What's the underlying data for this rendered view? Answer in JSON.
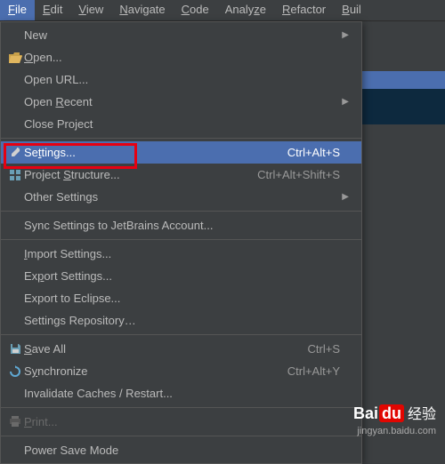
{
  "menubar": {
    "items": [
      {
        "pre": "",
        "u": "F",
        "post": "ile",
        "active": true
      },
      {
        "pre": "",
        "u": "E",
        "post": "dit"
      },
      {
        "pre": "",
        "u": "V",
        "post": "iew"
      },
      {
        "pre": "",
        "u": "N",
        "post": "avigate"
      },
      {
        "pre": "",
        "u": "C",
        "post": "ode"
      },
      {
        "pre": "Analy",
        "u": "z",
        "post": "e"
      },
      {
        "pre": "",
        "u": "R",
        "post": "efactor"
      },
      {
        "pre": "",
        "u": "B",
        "post": "uil"
      }
    ]
  },
  "menu": {
    "new": {
      "label": "New",
      "arrow": true
    },
    "open": {
      "pre": "",
      "u": "O",
      "post": "pen..."
    },
    "open_url": {
      "label": "Open URL..."
    },
    "open_recent": {
      "pre": "Open ",
      "u": "R",
      "post": "ecent",
      "arrow": true
    },
    "close_project": {
      "pre": "Close Pro",
      "u": "j",
      "post": "ect"
    },
    "settings": {
      "pre": "Se",
      "u": "t",
      "post": "tings...",
      "shortcut": "Ctrl+Alt+S"
    },
    "project_structure": {
      "pre": "Project ",
      "u": "S",
      "post": "tructure...",
      "shortcut": "Ctrl+Alt+Shift+S"
    },
    "other_settings": {
      "label": "Other Settings",
      "arrow": true
    },
    "sync_settings": {
      "label": "Sync Settings to JetBrains Account..."
    },
    "import_settings": {
      "pre": "",
      "u": "I",
      "post": "mport Settings..."
    },
    "export_settings": {
      "pre": "Ex",
      "u": "p",
      "post": "ort Settings..."
    },
    "export_eclipse": {
      "label": "Export to Eclipse..."
    },
    "settings_repo": {
      "label": "Settings Repository…"
    },
    "save_all": {
      "pre": "",
      "u": "S",
      "post": "ave All",
      "shortcut": "Ctrl+S"
    },
    "synchronize": {
      "pre": "S",
      "u": "y",
      "post": "nchronize",
      "shortcut": "Ctrl+Alt+Y"
    },
    "invalidate": {
      "label": "Invalidate Caches / Restart..."
    },
    "print": {
      "pre": "",
      "u": "P",
      "post": "rint...",
      "disabled": true
    },
    "power_save": {
      "label": "Power Save Mode"
    }
  },
  "watermark": {
    "brand_bai": "Bai",
    "brand_du": "du",
    "brand_jy": "经验",
    "url": "jingyan.baidu.com"
  }
}
